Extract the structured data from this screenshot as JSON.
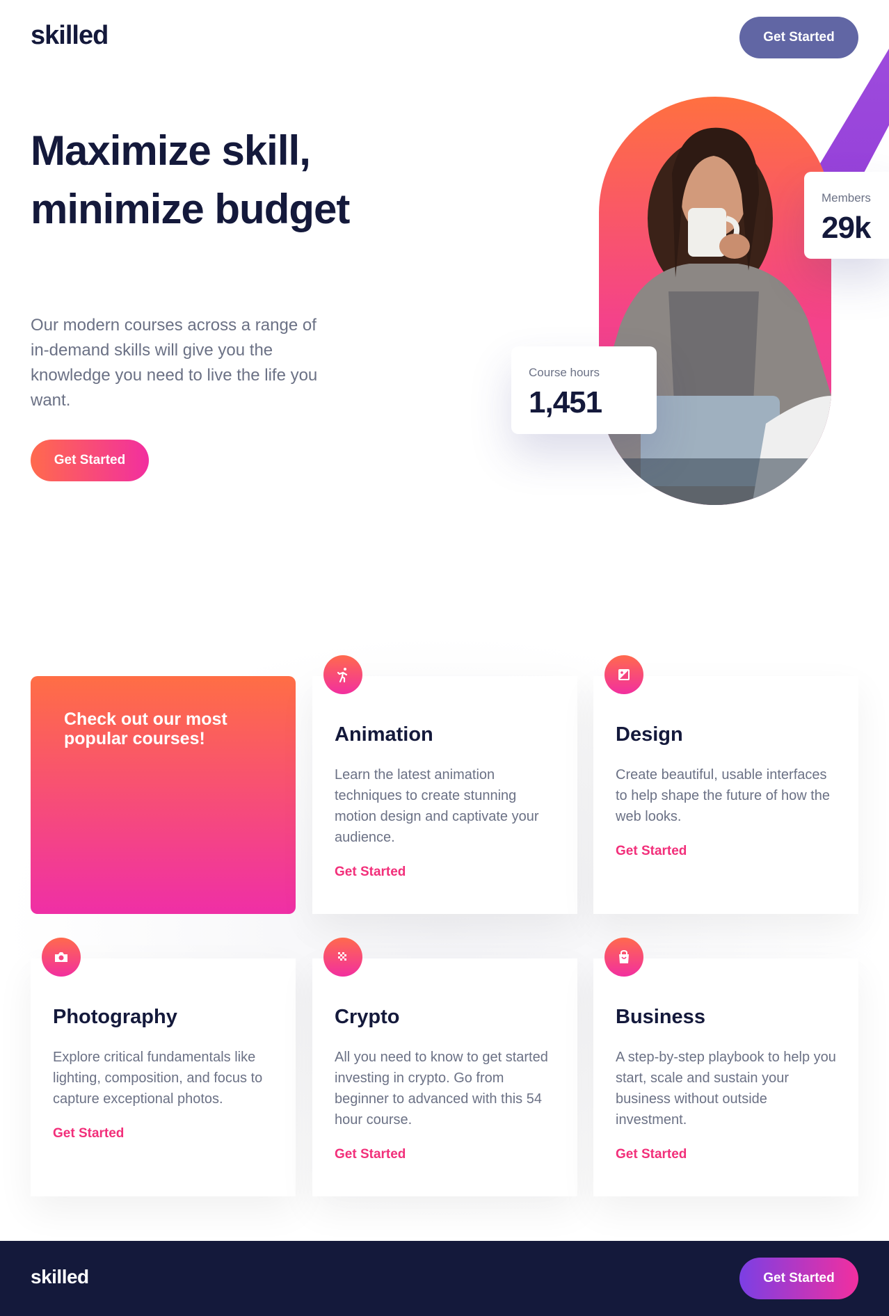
{
  "header": {
    "logo": "skilled",
    "cta_label": "Get Started"
  },
  "hero": {
    "title": "Maximize skill, minimize budget",
    "description": "Our modern courses across a range of in-demand skills will give you the knowledge you need to live the life you want.",
    "cta_label": "Get Started",
    "stats": {
      "members": {
        "label": "Members",
        "value": "29k"
      },
      "course_hours": {
        "label": "Course hours",
        "value": "1,451"
      }
    }
  },
  "courses": {
    "promo_text": "Check out our most popular courses!",
    "items": [
      {
        "title": "Animation",
        "description": "Learn the latest animation techniques to create stunning motion design and captivate your audience.",
        "link_label": "Get Started",
        "icon": "running-figure-icon"
      },
      {
        "title": "Design",
        "description": "Create beautiful, usable interfaces to help shape the future of how the web looks.",
        "link_label": "Get Started",
        "icon": "image-frame-icon"
      },
      {
        "title": "Photography",
        "description": "Explore critical fundamentals like lighting, composition, and focus to capture exceptional photos.",
        "link_label": "Get Started",
        "icon": "camera-icon"
      },
      {
        "title": "Crypto",
        "description": "All you need to know to get started investing in crypto. Go from beginner to advanced with this 54 hour course.",
        "link_label": "Get Started",
        "icon": "crypto-dots-icon"
      },
      {
        "title": "Business",
        "description": "A step-by-step playbook to help you start, scale and sustain your business without outside investment.",
        "link_label": "Get Started",
        "icon": "shopping-bag-icon"
      }
    ]
  },
  "footer": {
    "logo": "skilled",
    "cta_label": "Get Started"
  },
  "colors": {
    "navy": "#14193b",
    "header_button": "#6166a4",
    "gradient_start": "#ff6a4d",
    "gradient_end": "#f22f9f",
    "purple": "#7b3fe4",
    "muted_text": "#6b7185",
    "link": "#f22f7a"
  }
}
